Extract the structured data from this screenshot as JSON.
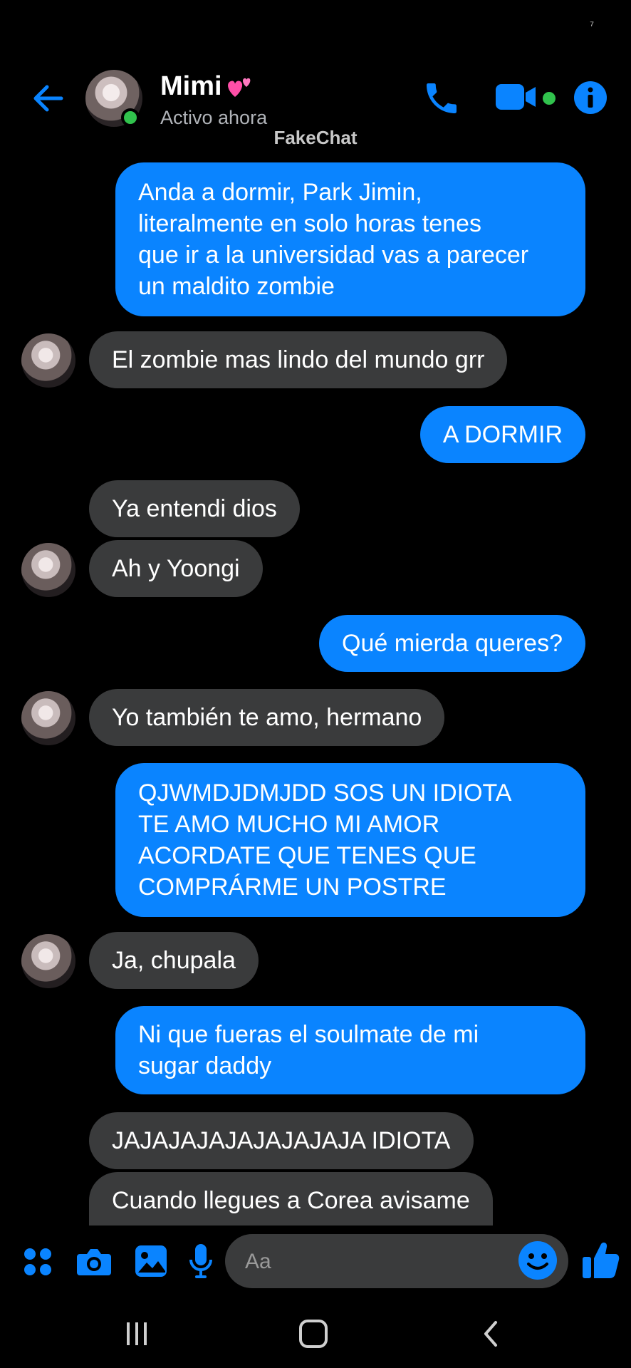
{
  "status_bar": {
    "signal_glyph": "⁷"
  },
  "header": {
    "contact_name": "Mimi",
    "contact_status": "Activo ahora",
    "watermark": "FakeChat",
    "icons": [
      "back-arrow-icon",
      "phone-icon",
      "video-camera-icon",
      "info-icon"
    ],
    "accent_color": "#0a84ff",
    "online_color": "#31c24d"
  },
  "messages": [
    {
      "from": "me",
      "lines": [
        "Anda a dormir, Park Jimin,",
        "literalmente en solo horas tenes",
        "que ir a la universidad vas a parecer",
        "un maldito zombie"
      ]
    },
    {
      "from": "them",
      "lines": [
        "El zombie mas lindo del mundo grr"
      ]
    },
    {
      "from": "me",
      "lines": [
        "A DORMIR"
      ]
    },
    {
      "from": "them",
      "lines": [
        "Ya entendi dios"
      ]
    },
    {
      "from": "them",
      "lines": [
        "Ah y Yoongi"
      ]
    },
    {
      "from": "me",
      "lines": [
        "Qué mierda queres?"
      ]
    },
    {
      "from": "them",
      "lines": [
        "Yo también te amo, hermano"
      ]
    },
    {
      "from": "me",
      "lines": [
        "QJWMDJDMJDD SOS UN IDIOTA",
        "TE AMO MUCHO MI AMOR",
        "ACORDATE QUE TENES QUE",
        "COMPRÁRME UN POSTRE"
      ]
    },
    {
      "from": "them",
      "lines": [
        "Ja, chupala"
      ]
    },
    {
      "from": "me",
      "lines": [
        "Ni que fueras el soulmate de mi",
        "sugar daddy"
      ]
    },
    {
      "from": "them",
      "lines": [
        "JAJAJAJAJAJAJAJAJA IDIOTA"
      ]
    },
    {
      "from": "them",
      "lines": [
        "Cuando llegues a Corea avisame"
      ]
    }
  ],
  "composer": {
    "placeholder": "Aa",
    "icons": [
      "apps-grid-icon",
      "camera-icon",
      "gallery-icon",
      "microphone-icon",
      "emoji-icon",
      "thumbs-up-icon"
    ]
  },
  "nav": {
    "icons": [
      "recents-icon",
      "home-icon",
      "back-icon"
    ]
  }
}
